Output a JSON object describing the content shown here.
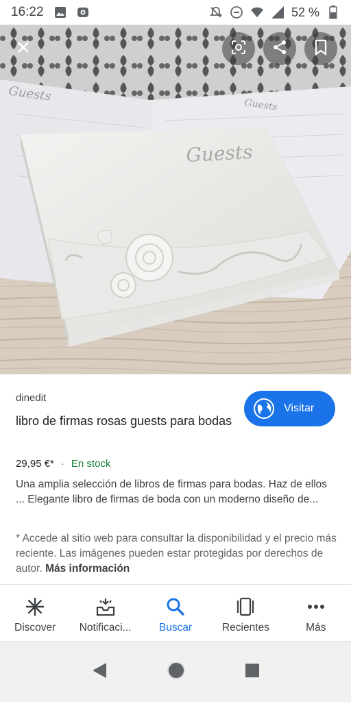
{
  "status_bar": {
    "time": "16:22",
    "battery": "52 %",
    "icons_left": [
      "gallery-icon",
      "lens-notification-icon"
    ],
    "icons_right": [
      "mute-icon",
      "dnd-icon",
      "wifi-icon",
      "signal-icon",
      "battery-icon"
    ]
  },
  "image_viewer": {
    "image_subject": "white guest book with roses",
    "image_text": "Guests",
    "actions": [
      "close-icon",
      "lens-icon",
      "share-icon",
      "bookmark-icon"
    ]
  },
  "result": {
    "source": "dinedit",
    "title": "libro de firmas rosas guests para bodas",
    "price": "29,95 €*",
    "separator": "·",
    "availability": "En stock",
    "description": "Una amplia selección de libros de firmas para bodas. Haz de ellos ... Elegante libro de firmas de boda con un moderno diseño de...",
    "disclaimer": "* Accede al sitio web para consultar la disponibilidad y el precio más reciente. Las imágenes pueden estar protegidas por derechos de autor.",
    "more_info": "Más información",
    "visit_label": "Visitar"
  },
  "bottom_nav": {
    "items": [
      {
        "label": "Discover",
        "icon": "asterisk-icon"
      },
      {
        "label": "Notificaci...",
        "icon": "inbox-bell-icon"
      },
      {
        "label": "Buscar",
        "icon": "search-icon"
      },
      {
        "label": "Recientes",
        "icon": "recents-icon"
      },
      {
        "label": "Más",
        "icon": "more-icon"
      }
    ],
    "active_index": 2
  },
  "colors": {
    "accent": "#1a73e8",
    "stock_green": "#188038"
  }
}
